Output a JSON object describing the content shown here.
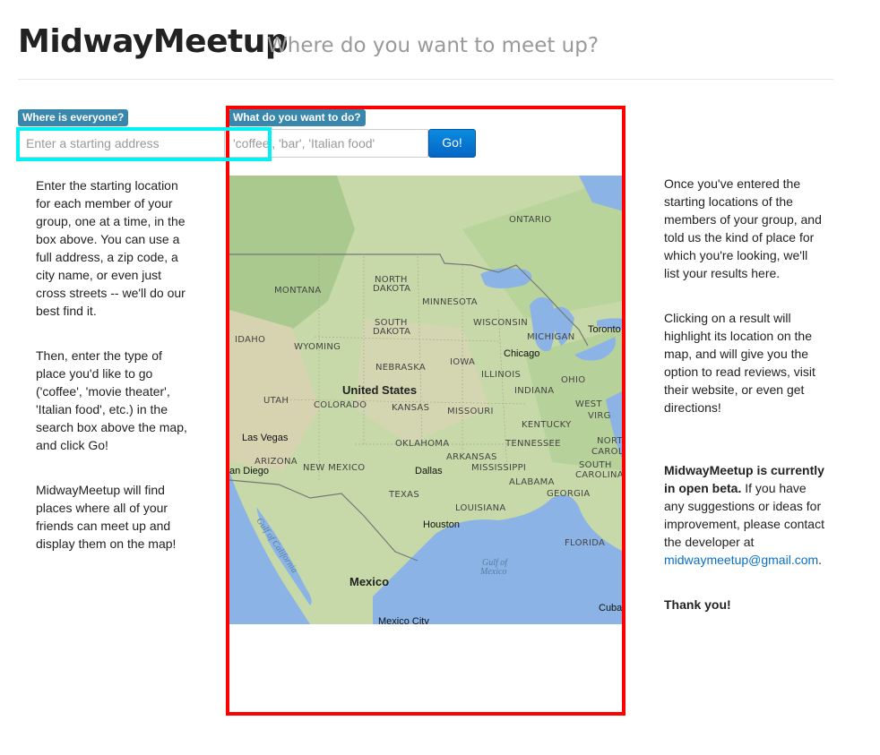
{
  "header": {
    "brand": "MidwayMeetup",
    "tagline": "Where do you want to meet up?"
  },
  "start": {
    "label": "Where is everyone?",
    "placeholder": "Enter a starting address"
  },
  "activity": {
    "label": "What do you want to do?",
    "placeholder": "'coffee', 'bar', 'Italian food'",
    "go_label": "Go!"
  },
  "left_column": {
    "p1": "Enter the starting location for each member of your group, one at a time, in the box above. You can use a full address, a zip code, a city name, or even just cross streets -- we'll do our best find it.",
    "p2": "Then, enter the type of place you'd like to go ('coffee', 'movie theater', 'Italian food', etc.) in the search box above the map, and click Go!",
    "p3": "MidwayMeetup will find places where all of your friends can meet up and display them on the map!"
  },
  "right_column": {
    "p1": "Once you've entered the starting locations of the members of your group, and told us the kind of place for which you're looking, we'll list your results here.",
    "p2": "Clicking on a result will highlight its location on the map, and will give you the option to read reviews, visit their website, or even get directions!",
    "beta_bold": "MidwayMeetup is currently in open beta.",
    "beta_rest": " If you have any suggestions or ideas for improvement, please contact the developer at ",
    "email": "midwaymeetup@gmail.com",
    "email_after": ".",
    "thanks": "Thank you!"
  },
  "map": {
    "labels": {
      "ontario": "ONTARIO",
      "north_dakota_1": "NORTH",
      "north_dakota_2": "DAKOTA",
      "montana": "MONTANA",
      "minnesota": "MINNESOTA",
      "south_dakota_1": "SOUTH",
      "south_dakota_2": "DAKOTA",
      "wisconsin": "WISCONSIN",
      "michigan": "MICHIGAN",
      "toronto": "Toronto",
      "idaho": "IDAHO",
      "wyoming": "WYOMING",
      "chicago": "Chicago",
      "iowa": "IOWA",
      "nebraska": "NEBRASKA",
      "illinois": "ILLINOIS",
      "ohio": "OHIO",
      "united_states": "United States",
      "utah": "UTAH",
      "colorado": "COLORADO",
      "indiana": "INDIANA",
      "kansas": "KANSAS",
      "missouri": "MISSOURI",
      "west": "WEST",
      "kentucky": "KENTUCKY",
      "virginia_frag": "VIRG",
      "las_vegas": "Las Vegas",
      "oklahoma": "OKLAHOMA",
      "tennessee": "TENNESSEE",
      "north_frag": "NORTH",
      "carolina_frag": "CAROLI",
      "arizona": "ARIZONA",
      "arkansas": "ARKANSAS",
      "san_diego": "an Diego",
      "new_mexico": "NEW MEXICO",
      "dallas": "Dallas",
      "mississippi": "MISSISSIPPI",
      "south": "SOUTH",
      "carolina": "CAROLINA",
      "alabama": "ALABAMA",
      "texas": "TEXAS",
      "georgia": "GEORGIA",
      "louisiana": "LOUISIANA",
      "houston": "Houston",
      "gulf_of_california": "Gulf of California",
      "florida": "FLORIDA",
      "gulf_of_mexico_1": "Gulf of",
      "gulf_of_mexico_2": "Mexico",
      "mexico": "Mexico",
      "mexico_city": "Mexico City",
      "cuba": "Cuba"
    }
  }
}
